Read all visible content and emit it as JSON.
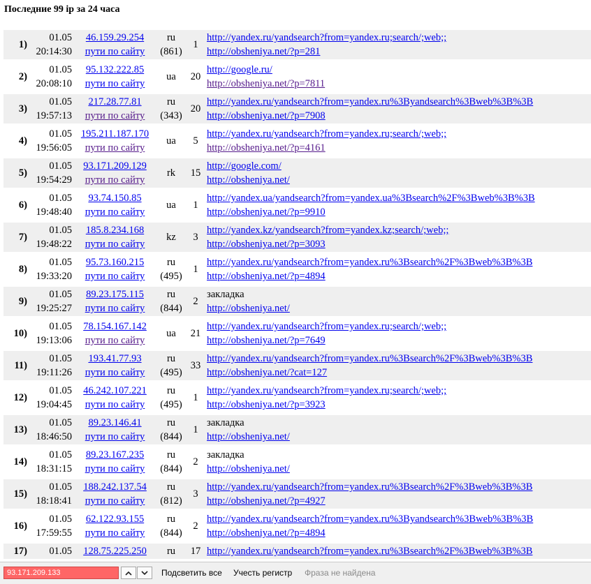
{
  "page": {
    "title": "Последние 99 ip за 24 часа"
  },
  "rows": [
    {
      "num": "1)",
      "date": "01.05",
      "time": "20:14:30",
      "ip": "46.159.29.254",
      "paths": "пути по сайту",
      "cc": "ru",
      "code": "(861)",
      "hits": "1",
      "ref": "http://yandex.ru/yandsearch?from=yandex.ru;search/;web;;",
      "page": "http://obsheniya.net/?p=281"
    },
    {
      "num": "2)",
      "date": "01.05",
      "time": "20:08:10",
      "ip": "95.132.222.85",
      "paths": "пути по сайту",
      "cc": "ua",
      "code": "",
      "hits": "20",
      "ref": "http://google.ru/",
      "page": "http://obsheniya.net/?p=7811"
    },
    {
      "num": "3)",
      "date": "01.05",
      "time": "19:57:13",
      "ip": "217.28.77.81",
      "paths": "пути по сайту",
      "cc": "ru",
      "code": "(343)",
      "hits": "20",
      "ref": "http://yandex.ru/yandsearch?from=yandex.ru%3Byandsearch%3Bweb%3B%3B",
      "page": "http://obsheniya.net/?p=7908"
    },
    {
      "num": "4)",
      "date": "01.05",
      "time": "19:56:05",
      "ip": "195.211.187.170",
      "paths": "пути по сайту",
      "cc": "ua",
      "code": "",
      "hits": "5",
      "ref": "http://yandex.ru/yandsearch?from=yandex.ru;search/;web;;",
      "page": "http://obsheniya.net/?p=4161"
    },
    {
      "num": "5)",
      "date": "01.05",
      "time": "19:54:29",
      "ip": "93.171.209.129",
      "paths": "пути по сайту",
      "cc": "rk",
      "code": "",
      "hits": "15",
      "ref": "http://google.com/",
      "page": "http://obsheniya.net/"
    },
    {
      "num": "6)",
      "date": "01.05",
      "time": "19:48:40",
      "ip": "93.74.150.85",
      "paths": "пути по сайту",
      "cc": "ua",
      "code": "",
      "hits": "1",
      "ref": "http://yandex.ua/yandsearch?from=yandex.ua%3Bsearch%2F%3Bweb%3B%3B",
      "page": "http://obsheniya.net/?p=9910"
    },
    {
      "num": "7)",
      "date": "01.05",
      "time": "19:48:22",
      "ip": "185.8.234.168",
      "paths": "пути по сайту",
      "cc": "kz",
      "code": "",
      "hits": "3",
      "ref": "http://yandex.kz/yandsearch?from=yandex.kz;search/;web;;",
      "page": "http://obsheniya.net/?p=3093"
    },
    {
      "num": "8)",
      "date": "01.05",
      "time": "19:33:20",
      "ip": "95.73.160.215",
      "paths": "пути по сайту",
      "cc": "ru",
      "code": "(495)",
      "hits": "1",
      "ref": "http://yandex.ru/yandsearch?from=yandex.ru%3Bsearch%2F%3Bweb%3B%3B",
      "page": "http://obsheniya.net/?p=4894"
    },
    {
      "num": "9)",
      "date": "01.05",
      "time": "19:25:27",
      "ip": "89.23.175.115",
      "paths": "пути по сайту",
      "cc": "ru",
      "code": "(844)",
      "hits": "2",
      "ref": "закладка",
      "page": "http://obsheniya.net/"
    },
    {
      "num": "10)",
      "date": "01.05",
      "time": "19:13:06",
      "ip": "78.154.167.142",
      "paths": "пути по сайту",
      "cc": "ua",
      "code": "",
      "hits": "21",
      "ref": "http://yandex.ru/yandsearch?from=yandex.ru;search/;web;;",
      "page": "http://obsheniya.net/?p=7649"
    },
    {
      "num": "11)",
      "date": "01.05",
      "time": "19:11:26",
      "ip": "193.41.77.93",
      "paths": "пути по сайту",
      "cc": "ru",
      "code": "(495)",
      "hits": "33",
      "ref": "http://yandex.ru/yandsearch?from=yandex.ru%3Bsearch%2F%3Bweb%3B%3B",
      "page": "http://obsheniya.net/?cat=127"
    },
    {
      "num": "12)",
      "date": "01.05",
      "time": "19:04:45",
      "ip": "46.242.107.221",
      "paths": "пути по сайту",
      "cc": "ru",
      "code": "(495)",
      "hits": "1",
      "ref": "http://yandex.ru/yandsearch?from=yandex.ru;search/;web;;",
      "page": "http://obsheniya.net/?p=3923"
    },
    {
      "num": "13)",
      "date": "01.05",
      "time": "18:46:50",
      "ip": "89.23.146.41",
      "paths": "пути по сайту",
      "cc": "ru",
      "code": "(844)",
      "hits": "1",
      "ref": "закладка",
      "page": "http://obsheniya.net/"
    },
    {
      "num": "14)",
      "date": "01.05",
      "time": "18:31:15",
      "ip": "89.23.167.235",
      "paths": "пути по сайту",
      "cc": "ru",
      "code": "(844)",
      "hits": "2",
      "ref": "закладка",
      "page": "http://obsheniya.net/"
    },
    {
      "num": "15)",
      "date": "01.05",
      "time": "18:18:41",
      "ip": "188.242.137.54",
      "paths": "пути по сайту",
      "cc": "ru",
      "code": "(812)",
      "hits": "3",
      "ref": "http://yandex.ru/yandsearch?from=yandex.ru%3Bsearch%2F%3Bweb%3B%3B",
      "page": "http://obsheniya.net/?p=4927"
    },
    {
      "num": "16)",
      "date": "01.05",
      "time": "17:59:55",
      "ip": "62.122.93.155",
      "paths": "пути по сайту",
      "cc": "ru",
      "code": "(844)",
      "hits": "2",
      "ref": "http://yandex.ru/yandsearch?from=yandex.ru%3Byandsearch%3Bweb%3B%3B",
      "page": "http://obsheniya.net/?p=4894"
    },
    {
      "num": "17)",
      "date": "01.05",
      "time": "",
      "ip": "128.75.225.250",
      "paths": "",
      "cc": "ru",
      "code": "",
      "hits": "17",
      "ref": "http://yandex.ru/yandsearch?from=yandex.ru%3Bsearch%2F%3Bweb%3B%3B",
      "page": ""
    }
  ],
  "findbar": {
    "query": "93.171.209.133",
    "highlight_all": "Подсветить все",
    "match_case": "Учесть регистр",
    "status": "Фраза не найдена",
    "input_bg": "#ff6666"
  }
}
